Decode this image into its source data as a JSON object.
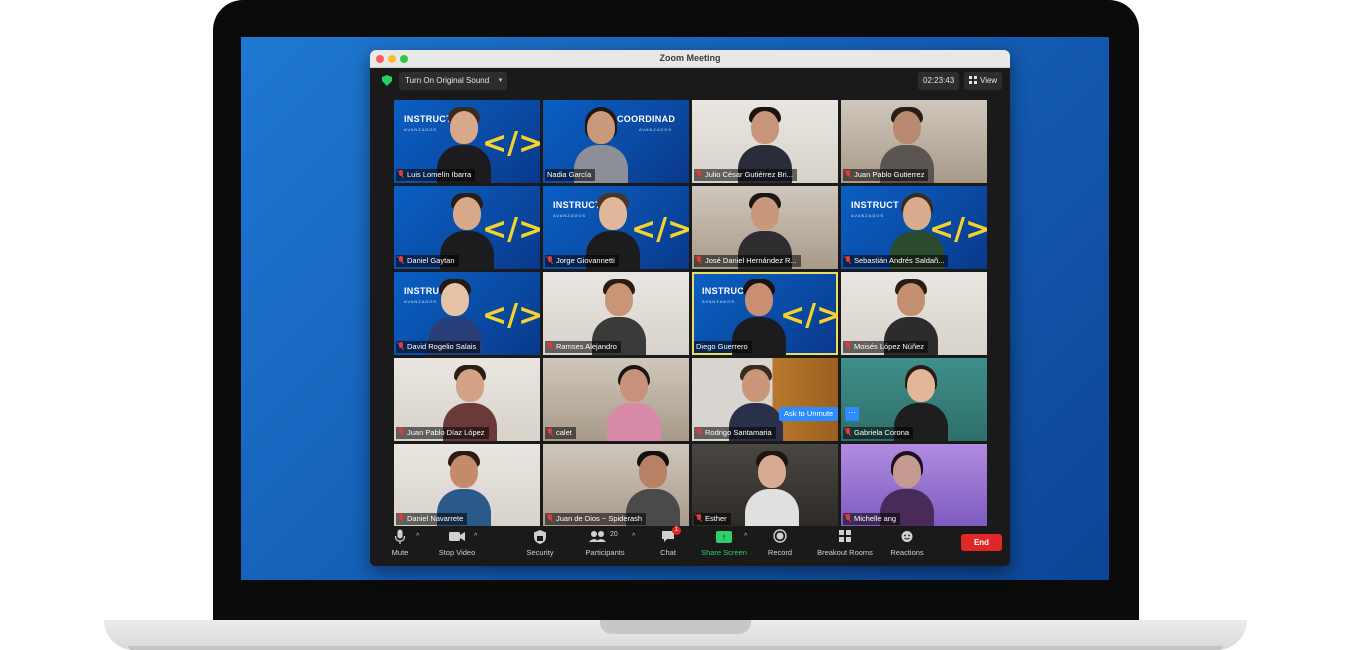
{
  "window": {
    "title": "Zoom Meeting"
  },
  "topbar": {
    "original_sound_label": "Turn On Original Sound",
    "timer": "02:23:43",
    "view_label": "View"
  },
  "brand_labels": {
    "instructor": "INSTRUCT",
    "coordinator": "COORDINAD",
    "sub": "AVANZADOS",
    "code_mark": "</>"
  },
  "participants": [
    {
      "name": "Luis Lomelín Ibarra"
    },
    {
      "name": "Nadia García"
    },
    {
      "name": "Julio César Gutiérrez Bri..."
    },
    {
      "name": "Juan Pablo Gutierrez"
    },
    {
      "name": "Daniel Gaytan"
    },
    {
      "name": "Jorge Giovannetti"
    },
    {
      "name": "José Daniel Hernández R..."
    },
    {
      "name": "Sebastián Andrés Saldañ..."
    },
    {
      "name": "David Rogelio Salais"
    },
    {
      "name": "Ramses Alejandro"
    },
    {
      "name": "Diego Guerrero"
    },
    {
      "name": "Moisés López Núñez"
    },
    {
      "name": "Juan Pablo Díaz López"
    },
    {
      "name": "calet"
    },
    {
      "name": "Rodrigo Santamaria"
    },
    {
      "name": "Gabriela Corona"
    },
    {
      "name": "Daniel Navarrete"
    },
    {
      "name": "Juan de Dios ~ Spiderash"
    },
    {
      "name": "Esther"
    },
    {
      "name": "Michelle ang"
    }
  ],
  "overlay": {
    "ask_unmute": "Ask to Unmute",
    "more": "···"
  },
  "toolbar": {
    "mute": "Mute",
    "stop_video": "Stop Video",
    "security": "Security",
    "participants": "Participants",
    "participants_count": "20",
    "chat": "Chat",
    "chat_badge": "1",
    "share_screen": "Share Screen",
    "record": "Record",
    "breakout_rooms": "Breakout Rooms",
    "reactions": "Reactions",
    "end": "End"
  },
  "colors": {
    "end_red": "#e02828",
    "share_green": "#2fcf6a",
    "zoom_blue": "#2d8cff",
    "active_speaker": "#e9dd63"
  }
}
